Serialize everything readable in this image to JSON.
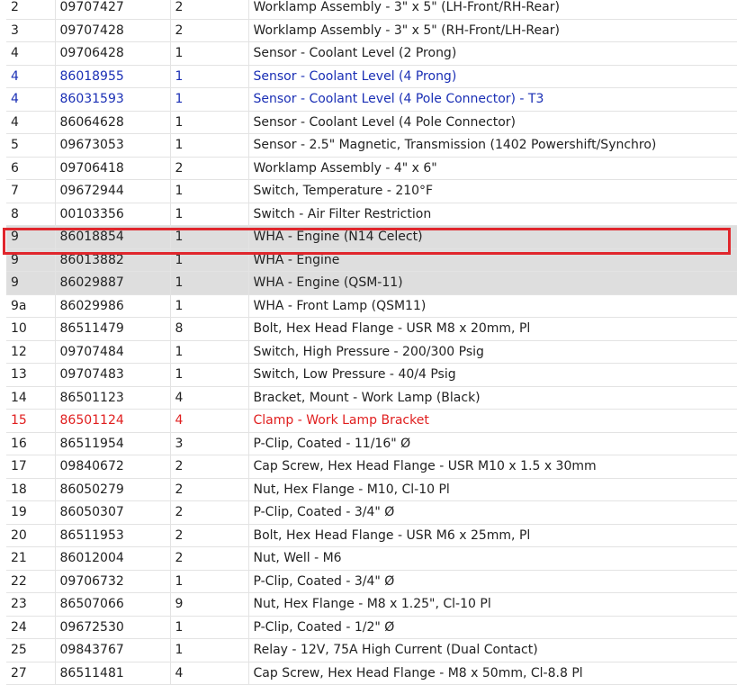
{
  "table": {
    "rows": [
      {
        "item": "2",
        "part": "09707427",
        "qty": "2",
        "desc": "Worklamp Assembly - 3\" x 5\" (LH-Front/RH-Rear)",
        "style": ""
      },
      {
        "item": "3",
        "part": "09707428",
        "qty": "2",
        "desc": "Worklamp Assembly - 3\" x 5\" (RH-Front/LH-Rear)",
        "style": ""
      },
      {
        "item": "4",
        "part": "09706428",
        "qty": "1",
        "desc": "Sensor - Coolant Level (2 Prong)",
        "style": ""
      },
      {
        "item": "4",
        "part": "86018955",
        "qty": "1",
        "desc": "Sensor - Coolant Level (4 Prong)",
        "style": "blue"
      },
      {
        "item": "4",
        "part": "86031593",
        "qty": "1",
        "desc": "Sensor - Coolant Level (4 Pole Connector) - T3",
        "style": "blue"
      },
      {
        "item": "4",
        "part": "86064628",
        "qty": "1",
        "desc": "Sensor - Coolant Level (4 Pole Connector)",
        "style": ""
      },
      {
        "item": "5",
        "part": "09673053",
        "qty": "1",
        "desc": "Sensor - 2.5\" Magnetic, Transmission (1402 Powershift/Synchro)",
        "style": ""
      },
      {
        "item": "6",
        "part": "09706418",
        "qty": "2",
        "desc": "Worklamp Assembly - 4\" x 6\"",
        "style": ""
      },
      {
        "item": "7",
        "part": "09672944",
        "qty": "1",
        "desc": "Switch, Temperature - 210°F",
        "style": ""
      },
      {
        "item": "8",
        "part": "00103356",
        "qty": "1",
        "desc": "Switch - Air Filter Restriction",
        "style": ""
      },
      {
        "item": "9",
        "part": "86018854",
        "qty": "1",
        "desc": "WHA - Engine (N14 Celect)",
        "style": "gray"
      },
      {
        "item": "9",
        "part": "86013882",
        "qty": "1",
        "desc": "WHA - Engine",
        "style": "gray"
      },
      {
        "item": "9",
        "part": "86029887",
        "qty": "1",
        "desc": "WHA - Engine (QSM-11)",
        "style": "gray"
      },
      {
        "item": "9a",
        "part": "86029986",
        "qty": "1",
        "desc": "WHA - Front Lamp (QSM11)",
        "style": ""
      },
      {
        "item": "10",
        "part": "86511479",
        "qty": "8",
        "desc": "Bolt, Hex Head Flange - USR M8 x 20mm, Pl",
        "style": ""
      },
      {
        "item": "12",
        "part": "09707484",
        "qty": "1",
        "desc": "Switch, High Pressure - 200/300 Psig",
        "style": ""
      },
      {
        "item": "13",
        "part": "09707483",
        "qty": "1",
        "desc": "Switch, Low Pressure - 40/4 Psig",
        "style": ""
      },
      {
        "item": "14",
        "part": "86501123",
        "qty": "4",
        "desc": "Bracket, Mount - Work Lamp (Black)",
        "style": ""
      },
      {
        "item": "15",
        "part": "86501124",
        "qty": "4",
        "desc": "Clamp - Work Lamp Bracket",
        "style": "red"
      },
      {
        "item": "16",
        "part": "86511954",
        "qty": "3",
        "desc": "P-Clip, Coated - 11/16\" Ø",
        "style": ""
      },
      {
        "item": "17",
        "part": "09840672",
        "qty": "2",
        "desc": "Cap Screw, Hex Head Flange - USR M10 x 1.5 x 30mm",
        "style": ""
      },
      {
        "item": "18",
        "part": "86050279",
        "qty": "2",
        "desc": "Nut, Hex Flange - M10, Cl-10 Pl",
        "style": ""
      },
      {
        "item": "19",
        "part": "86050307",
        "qty": "2",
        "desc": "P-Clip, Coated - 3/4\" Ø",
        "style": ""
      },
      {
        "item": "20",
        "part": "86511953",
        "qty": "2",
        "desc": "Bolt, Hex Head Flange - USR M6 x 25mm, Pl",
        "style": ""
      },
      {
        "item": "21",
        "part": "86012004",
        "qty": "2",
        "desc": "Nut, Well - M6",
        "style": ""
      },
      {
        "item": "22",
        "part": "09706732",
        "qty": "1",
        "desc": "P-Clip, Coated - 3/4\" Ø",
        "style": ""
      },
      {
        "item": "23",
        "part": "86507066",
        "qty": "9",
        "desc": "Nut, Hex Flange - M8 x 1.25\", Cl-10 Pl",
        "style": ""
      },
      {
        "item": "24",
        "part": "09672530",
        "qty": "1",
        "desc": "P-Clip, Coated - 1/2\" Ø",
        "style": ""
      },
      {
        "item": "25",
        "part": "09843767",
        "qty": "1",
        "desc": "Relay - 12V, 75A High Current (Dual Contact)",
        "style": ""
      },
      {
        "item": "27",
        "part": "86511481",
        "qty": "4",
        "desc": "Cap Screw, Hex Head Flange - M8 x 50mm, Cl-8.8 Pl",
        "style": ""
      }
    ],
    "highlighted_row_index": 10
  },
  "colors": {
    "link_blue": "#1a2fb5",
    "alert_red": "#e01e1e",
    "highlight_border": "#e0262c",
    "row_gray": "#dedede"
  }
}
